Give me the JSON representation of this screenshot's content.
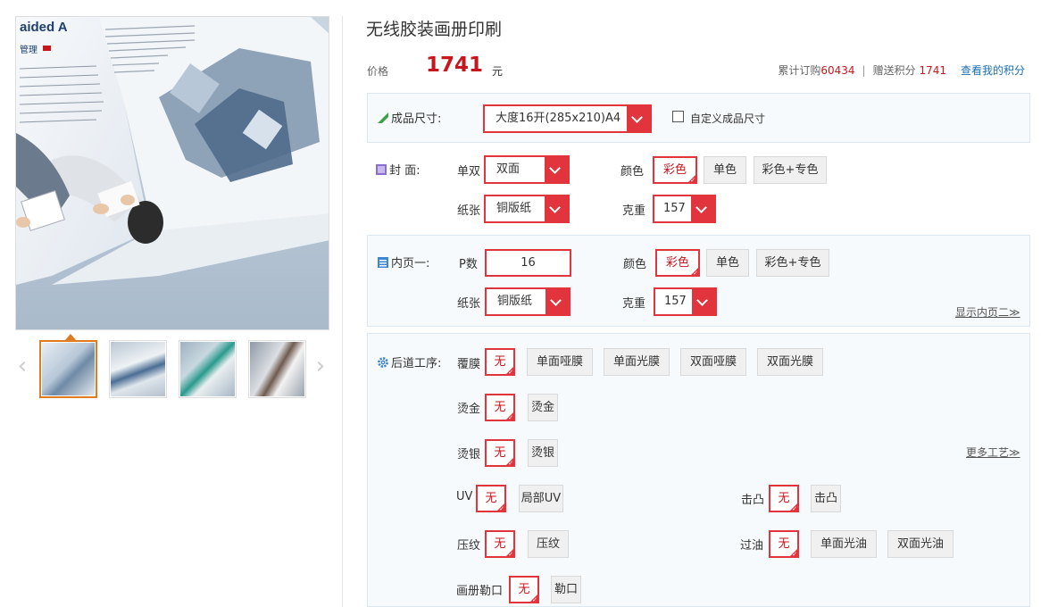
{
  "product": {
    "title": "无线胶装画册印刷",
    "price_label": "价格",
    "price": "1741",
    "price_unit": "元",
    "stats": {
      "orders_label": "累计订购",
      "orders": "60434",
      "separator": "|",
      "points_label": "赠送积分",
      "points": "1741",
      "points_link": "查看我的积分"
    }
  },
  "gallery": {
    "prev_arrow": "‹",
    "next_arrow": "›",
    "thumbnail_count": 4,
    "selected_index": 0,
    "cover_text": "aided A",
    "cover_text_2": "管理"
  },
  "size_section": {
    "label": "成品尺寸:",
    "selected": "大度16开(285x210)A4",
    "custom_label": "自定义成品尺寸"
  },
  "cover_section": {
    "label": "封  面:",
    "sides_label": "单双",
    "sides_value": "双面",
    "color_label": "颜色",
    "color_options": [
      "彩色",
      "单色",
      "彩色+专色"
    ],
    "paper_label": "纸张",
    "paper_value": "铜版纸",
    "weight_label": "克重",
    "weight_value": "157"
  },
  "inner_section": {
    "label": "内页一:",
    "pages_label": "P数",
    "pages_value": "16",
    "color_label": "颜色",
    "color_options": [
      "彩色",
      "单色",
      "彩色+专色"
    ],
    "paper_label": "纸张",
    "paper_value": "铜版纸",
    "weight_label": "克重",
    "weight_value": "157",
    "show_more": "显示内页二≫"
  },
  "finishing_section": {
    "label": "后道工序:",
    "lamination_label": "覆膜",
    "lamination_options": [
      "无",
      "单面哑膜",
      "单面光膜",
      "双面哑膜",
      "双面光膜"
    ],
    "gold_label": "烫金",
    "gold_options": [
      "无",
      "烫金"
    ],
    "silver_label": "烫银",
    "silver_options": [
      "无",
      "烫银"
    ],
    "more_link": "更多工艺≫",
    "uv_label": "UV",
    "uv_options": [
      "无",
      "局部UV"
    ],
    "emboss_label": "击凸",
    "emboss_options": [
      "无",
      "击凸"
    ],
    "press_label": "压纹",
    "press_options": [
      "无",
      "压纹"
    ],
    "varnish_label": "过油",
    "varnish_options": [
      "无",
      "单面光油",
      "双面光油"
    ],
    "crease_label": "画册勒口",
    "crease_options": [
      "无",
      "勒口"
    ]
  },
  "colors": {
    "accent": "#e2343d",
    "price": "#c8161d",
    "link": "#1a6fb5"
  }
}
